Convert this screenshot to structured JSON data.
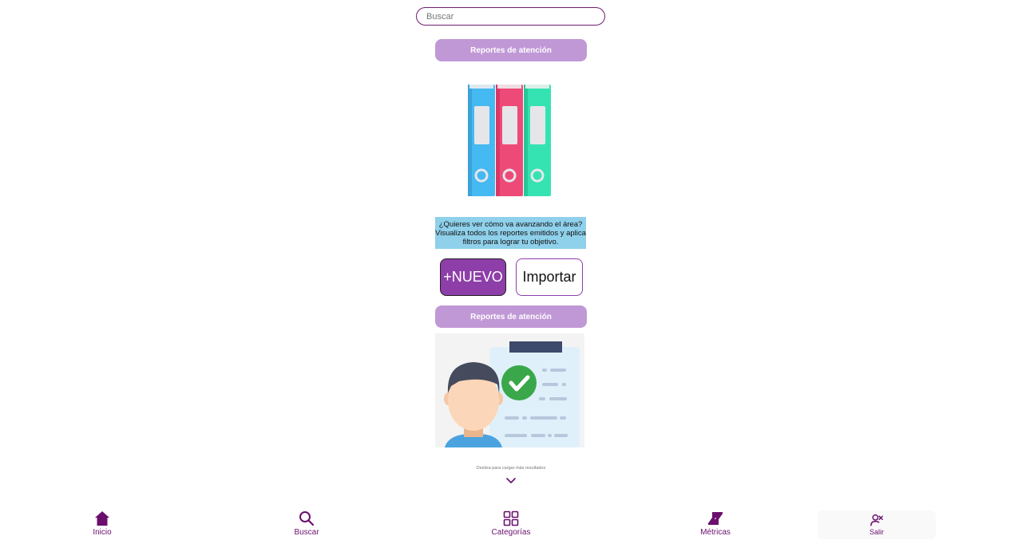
{
  "search": {
    "placeholder": "Buscar",
    "value": ""
  },
  "sections": [
    {
      "title": "Reportes de atención",
      "image_icon": "binders-icon",
      "description": "¿Quieres ver cómo va avanzando el área? Visualiza todos los reportes emitidos y aplica filtros para lograr tu objetivo."
    },
    {
      "title": "Reportes de atención",
      "image_icon": "person-report-icon"
    }
  ],
  "actions": {
    "new_label": "+NUEVO",
    "import_label": "Importar"
  },
  "scroll_hint": "Desliza para cargar más resultados",
  "nav": [
    {
      "label": "Inicio",
      "icon": "home-icon"
    },
    {
      "label": "Buscar",
      "icon": "search-icon"
    },
    {
      "label": "Categorías",
      "icon": "grid-icon"
    },
    {
      "label": "Métricas",
      "icon": "metrics-logo-icon"
    },
    {
      "label": "Salir",
      "icon": "user-remove-icon"
    }
  ],
  "colors": {
    "accent": "#6a0f6e",
    "banner": "#c198d6",
    "info_bg": "#8fd0ea",
    "primary_button": "#8d3ea8"
  }
}
